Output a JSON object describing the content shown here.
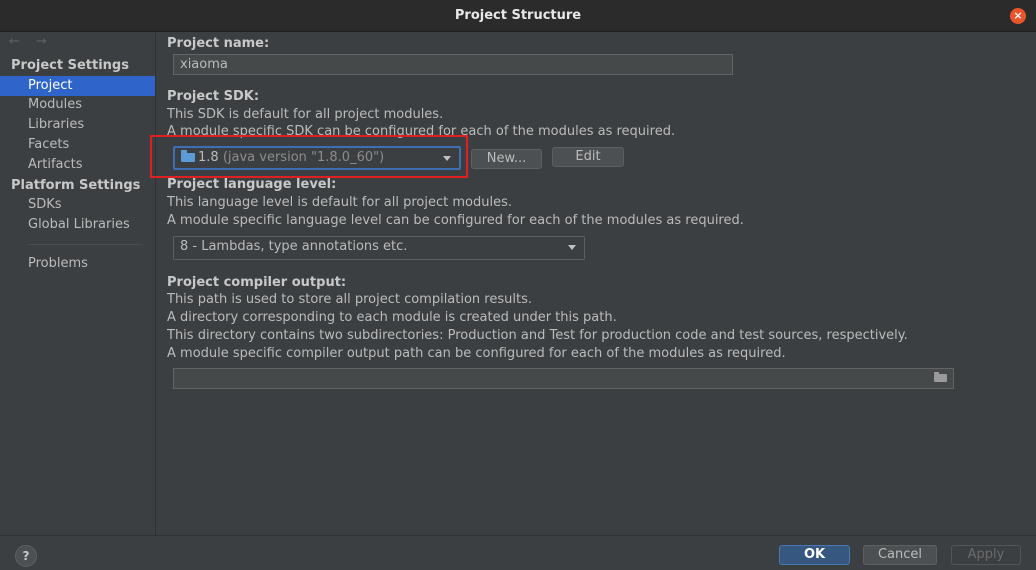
{
  "window": {
    "title": "Project Structure",
    "close_glyph": "×"
  },
  "sidebar": {
    "nav_arrows": "← →",
    "project_settings_header": "Project Settings",
    "project_items": [
      "Project",
      "Modules",
      "Libraries",
      "Facets",
      "Artifacts"
    ],
    "platform_settings_header": "Platform Settings",
    "platform_items": [
      "SDKs",
      "Global Libraries"
    ],
    "problems": "Problems",
    "selected": "Project"
  },
  "project_name": {
    "label": "Project name:",
    "value": "xiaoma"
  },
  "project_sdk": {
    "label": "Project SDK:",
    "desc1": "This SDK is default for all project modules.",
    "desc2": "A module specific SDK can be configured for each of the modules as required.",
    "selected_version": "1.8",
    "selected_detail": "(java version \"1.8.0_60\")",
    "new_button": "New...",
    "edit_button": "Edit"
  },
  "language_level": {
    "label": "Project language level:",
    "desc1": "This language level is default for all project modules.",
    "desc2": "A module specific language level can be configured for each of the modules as required.",
    "selected": "8 - Lambdas, type annotations etc."
  },
  "compiler_output": {
    "label": "Project compiler output:",
    "desc1": "This path is used to store all project compilation results.",
    "desc2": "A directory corresponding to each module is created under this path.",
    "desc3": "This directory contains two subdirectories: Production and Test for production code and test sources, respectively.",
    "desc4": "A module specific compiler output path can be configured for each of the modules as required.",
    "value": ""
  },
  "footer": {
    "help": "?",
    "ok": "OK",
    "cancel": "Cancel",
    "apply": "Apply"
  },
  "colors": {
    "selection": "#2f65ca",
    "highlight_box": "#e02020",
    "ok_button": "#365880",
    "close_button": "#e9542b"
  }
}
